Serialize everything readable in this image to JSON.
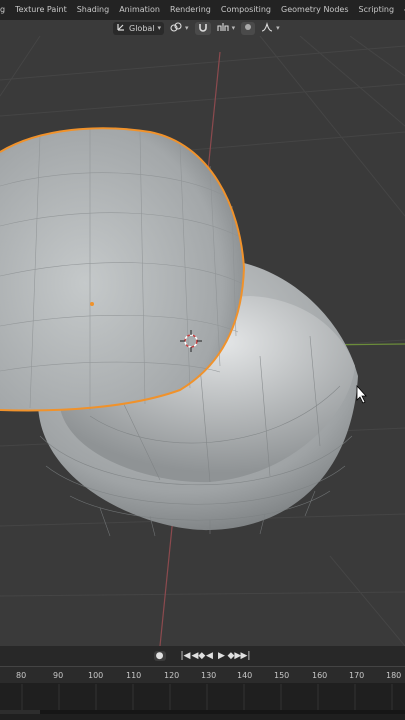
{
  "workspace_tabs": [
    "g",
    "Texture Paint",
    "Shading",
    "Animation",
    "Rendering",
    "Compositing",
    "Geometry Nodes",
    "Scripting"
  ],
  "add_workspace_label": "+",
  "toolbar": {
    "transform_orientation": "Global",
    "orientation_arrow": "▾",
    "pivot_arrow": "▾",
    "snap_arrow": "▾",
    "proportional_arrow": "▾"
  },
  "timeline": {
    "controls": [
      "●",
      "|◀",
      "◀◆",
      "◀",
      "▶",
      "◆▶",
      "▶|"
    ],
    "frame_ticks": [
      "80",
      "90",
      "100",
      "110",
      "120",
      "130",
      "140",
      "150",
      "160",
      "170",
      "180"
    ]
  },
  "colors": {
    "selection_outline": "#f0922b",
    "x_axis": "#8c4a4e",
    "y_axis": "#6b8c3a",
    "mesh": "#a9adae",
    "background": "#3a3a3a"
  }
}
